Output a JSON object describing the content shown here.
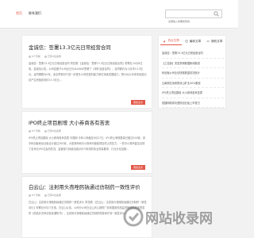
{
  "header": {
    "nav": [
      "首页",
      "联系我们"
    ],
    "search": {
      "placeholder": "这里输入你要搜索的"
    }
  },
  "articles": [
    {
      "title": "金诚信：签署13.3亿元日常经营合同",
      "meta": [
        "9个月前",
        "已有4位读者"
      ],
      "summary": "金诚信：签署13.3亿元日常经营合同 同花顺 【金诚信：签署13.3亿元日常经营合同】财联社10月8日电，金诚信公告，公司控股子公司近日与ALKANE签署了《采矿运营合同》，合同额约为人民币13.3亿元。合同期限为5年。该合同有利于进一步提升公司的盈利能力和可持续发展能力，预计对公司未来经营业绩产生积极影响约13.3亿元...",
      "more": "阅读全文"
    },
    {
      "title": "IPO终止项目剧增 大小券商各有苦衷",
      "meta": [
        "8个月前",
        "已有6位读者"
      ],
      "summary": "IPO终止项目剧增 大小券商各有苦衷 中国网 今年以来截至9月27日，IPO终止审核数量已超过500家，其中科创板和创业板合计超过300家。大型券商和中小券商均面临项目终止的压力，一些中小券商甚至出现了全年无IPO过会的情况，监管部门持续加强对中介机构的执业质量要求，行业分化加剧...",
      "more": "阅读全文"
    },
    {
      "title": "白云山：注射用头孢唑肟钠通过仿制药一致性评价",
      "meta": [
        "8个月前",
        "已有6位读者"
      ],
      "summary": "白云山：注射用头孢唑肟钠通过仿制药一致性评价 同花顺 【白云山：注射用头孢唑肟钠通过仿制药一致性评价】财联社9月27日电，白云山公告，公司分公司白云山天心制药厂收到国家药品监督管理局核准签发的《药品补充申请批准通知书》，注射用头孢唑肟钠通过仿制药质量和疗效一致性评价...",
      "more": "阅读全文"
    }
  ],
  "sidebar": {
    "tabs": [
      "热点文章",
      "最新文章",
      "随机文章"
    ],
    "items": [
      "金诚信：签署13.3亿元日常经营合同",
      "【工信部】突发重磅数据新闻报道",
      "科创板公司业绩快报披露情况统计",
      "云南铜业拟收购凉山矿业40%股权",
      "IPO终止项目剧增 大小券商各有苦衷",
      "锐捷网络成功登陆创业板上市首日"
    ]
  },
  "watermark": {
    "text": "网站收录网"
  },
  "colors": {
    "accent": "#e2584a",
    "watermark_text": "#5a5a5a"
  }
}
